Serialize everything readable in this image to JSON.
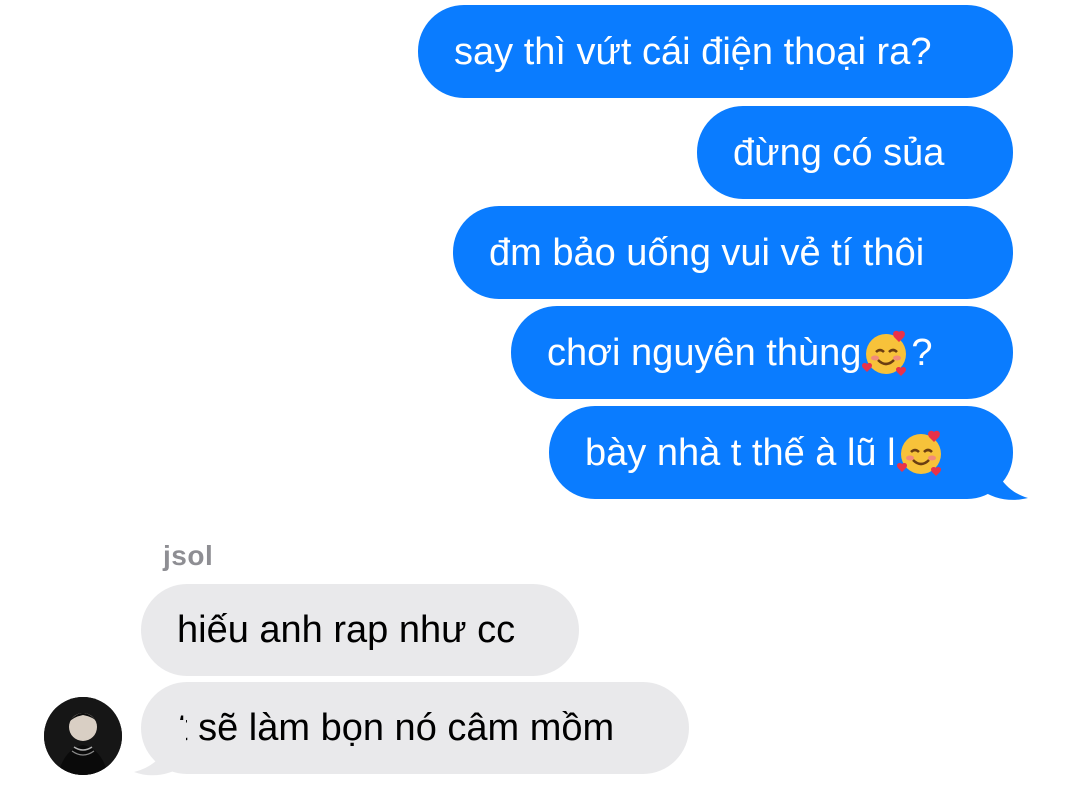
{
  "outgoing": [
    {
      "text": "say thì vứt cái điện thoại ra?"
    },
    {
      "text": "đừng có sủa"
    },
    {
      "text": "đm bảo uống vui vẻ tí thôi"
    },
    {
      "pre": "chơi nguyên thùng",
      "emoji": "smiling-face-with-hearts-icon",
      "post": "?"
    },
    {
      "pre": "bày nhà t thế à lũ l",
      "emoji": "smiling-face-with-hearts-icon",
      "post": ""
    }
  ],
  "sender_name": "jsol",
  "incoming": [
    {
      "text": "hiếu anh rap như cc"
    },
    {
      "text": "t sẽ làm bọn nó câm mồm"
    }
  ],
  "colors": {
    "outgoing_bubble": "#0a7cff",
    "incoming_bubble": "#e9e9eb",
    "sender_name": "#8e8e93"
  }
}
